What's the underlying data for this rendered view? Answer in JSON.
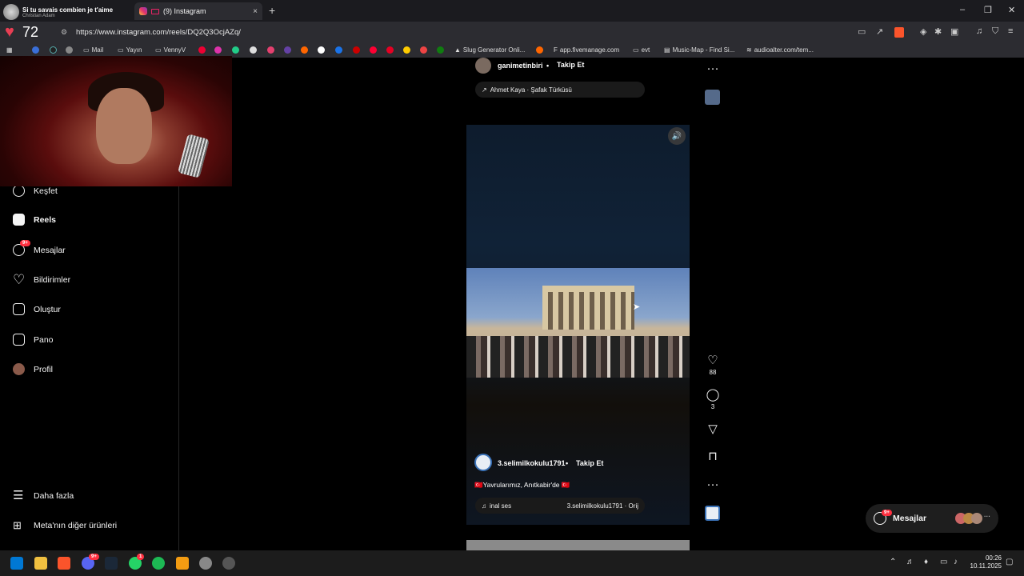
{
  "browser": {
    "media": {
      "title": "Si tu savais combien je t'aime",
      "artist": "Christian Adam"
    },
    "tab": {
      "count_prefix": "(9)",
      "title": "(9) Instagram",
      "close": "×"
    },
    "new_tab": "+",
    "heart_count": "72",
    "url": "https://www.instagram.com/reels/DQ2Q3OcjAZq/",
    "window": {
      "minimize": "–",
      "maximize": "❐",
      "close": "✕"
    }
  },
  "bookmarks": [
    {
      "label": "Mail"
    },
    {
      "label": "Yayın"
    },
    {
      "label": "VennyV"
    },
    {
      "label": "Slug Generator Onli..."
    },
    {
      "label": "app.fivemanage.com"
    },
    {
      "label": "evt"
    },
    {
      "label": "Music-Map - Find Si..."
    },
    {
      "label": "audioalter.com/tem..."
    }
  ],
  "sidebar": {
    "items": [
      {
        "label": "Keşfet"
      },
      {
        "label": "Reels"
      },
      {
        "label": "Mesajlar",
        "badge": "9+"
      },
      {
        "label": "Bildirimler"
      },
      {
        "label": "Oluştur"
      },
      {
        "label": "Pano"
      },
      {
        "label": "Profil"
      }
    ],
    "more": "Daha fazla",
    "meta": "Meta'nın diğer ürünleri"
  },
  "reel_prev": {
    "username": "ganimetinbiri",
    "follow": "Takip Et",
    "music": "Ahmet Kaya · Şafak Türküsü"
  },
  "reel": {
    "username": "3.selimilkokulu1791",
    "follow": "Takip Et",
    "caption": "🇹🇷Yavrularımız, Anıtkabir'de 🇹🇷",
    "audio_left": "inal ses",
    "audio_right": "3.selimilkokulu1791 · Orij",
    "likes": "88",
    "comments": "3"
  },
  "messages_button": {
    "label": "Mesajlar",
    "badge": "9+"
  },
  "taskbar": {
    "time": "00:26",
    "date": "10.11.2025",
    "badge_discord": "9+",
    "badge_whatsapp": "1"
  },
  "colors": {
    "accent_red": "#ff3040",
    "heart": "#e83e53",
    "background": "#000000"
  }
}
